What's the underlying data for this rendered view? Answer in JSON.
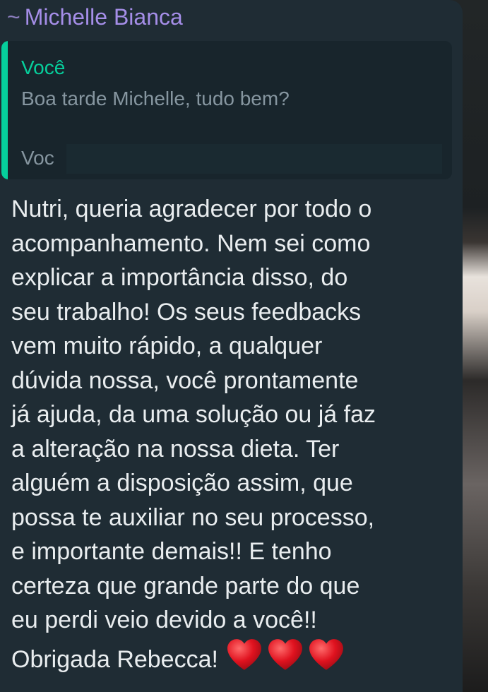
{
  "chat": {
    "sender_prefix": "~",
    "sender_name": "Michelle Bianca",
    "sender_color": "#a58ee8",
    "accent_color": "#06cf9c"
  },
  "quoted": {
    "author": "Você",
    "text": "Boa tarde Michelle, tudo bem?",
    "second_author": "Voc"
  },
  "message": {
    "lines": [
      "Nutri, queria agradecer por todo o",
      "acompanhamento. Nem sei como",
      "explicar a importância disso, do",
      "seu trabalho! Os seus feedbacks",
      "vem muito rápido, a qualquer",
      "dúvida nossa, você prontamente",
      "já ajuda, da uma solução ou já faz",
      "a alteração na nossa dieta. Ter",
      "alguém a disposição assim, que",
      "possa te auxiliar no seu processo,",
      "e importante demais!! E tenho",
      "certeza que grande parte do que",
      "eu perdi veio devido a você!!",
      "Obrigada Rebecca!"
    ],
    "emoji": [
      "red-heart-icon",
      "red-heart-icon",
      "red-heart-icon"
    ]
  }
}
